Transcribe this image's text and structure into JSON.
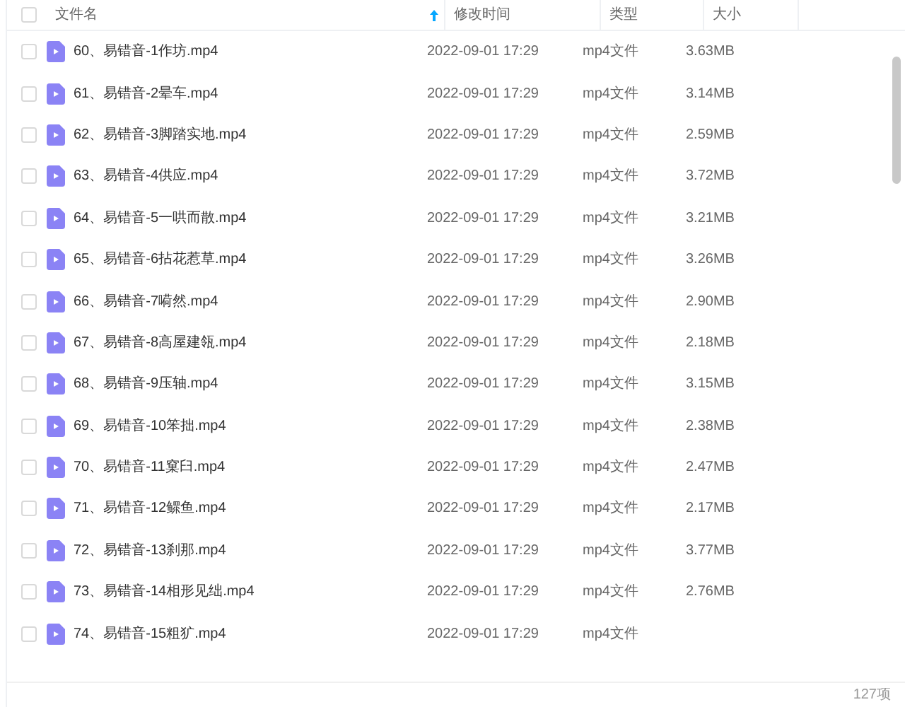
{
  "table": {
    "select_all": {
      "checked": false
    },
    "columns": [
      {
        "label": "文件名",
        "sorted": true
      },
      {
        "label": "修改时间",
        "sorted": false
      },
      {
        "label": "类型",
        "sorted": false
      },
      {
        "label": "大小",
        "sorted": false
      }
    ],
    "rows": [
      {
        "name": "60、易错音-1作坊.mp4",
        "modified": "2022-09-01 17:29",
        "type": "mp4文件",
        "size": "3.63MB",
        "selected": false
      },
      {
        "name": "61、易错音-2晕车.mp4",
        "modified": "2022-09-01 17:29",
        "type": "mp4文件",
        "size": "3.14MB",
        "selected": false
      },
      {
        "name": "62、易错音-3脚踏实地.mp4",
        "modified": "2022-09-01 17:29",
        "type": "mp4文件",
        "size": "2.59MB",
        "selected": false
      },
      {
        "name": "63、易错音-4供应.mp4",
        "modified": "2022-09-01 17:29",
        "type": "mp4文件",
        "size": "3.72MB",
        "selected": false
      },
      {
        "name": "64、易错音-5一哄而散.mp4",
        "modified": "2022-09-01 17:29",
        "type": "mp4文件",
        "size": "3.21MB",
        "selected": false
      },
      {
        "name": "65、易错音-6拈花惹草.mp4",
        "modified": "2022-09-01 17:29",
        "type": "mp4文件",
        "size": "3.26MB",
        "selected": false
      },
      {
        "name": "66、易错音-7嗬然.mp4",
        "modified": "2022-09-01 17:29",
        "type": "mp4文件",
        "size": "2.90MB",
        "selected": false
      },
      {
        "name": "67、易错音-8高屋建瓴.mp4",
        "modified": "2022-09-01 17:29",
        "type": "mp4文件",
        "size": "2.18MB",
        "selected": false
      },
      {
        "name": "68、易错音-9压轴.mp4",
        "modified": "2022-09-01 17:29",
        "type": "mp4文件",
        "size": "3.15MB",
        "selected": false
      },
      {
        "name": "69、易错音-10笨拙.mp4",
        "modified": "2022-09-01 17:29",
        "type": "mp4文件",
        "size": "2.38MB",
        "selected": false
      },
      {
        "name": "70、易错音-11窠臼.mp4",
        "modified": "2022-09-01 17:29",
        "type": "mp4文件",
        "size": "2.47MB",
        "selected": false
      },
      {
        "name": "71、易错音-12鳏鱼.mp4",
        "modified": "2022-09-01 17:29",
        "type": "mp4文件",
        "size": "2.17MB",
        "selected": false
      },
      {
        "name": "72、易错音-13刹那.mp4",
        "modified": "2022-09-01 17:29",
        "type": "mp4文件",
        "size": "3.77MB",
        "selected": false
      },
      {
        "name": "73、易错音-14相形见绌.mp4",
        "modified": "2022-09-01 17:29",
        "type": "mp4文件",
        "size": "2.76MB",
        "selected": false
      },
      {
        "name": "74、易错音-15粗犷.mp4",
        "modified": "2022-09-01 17:29",
        "type": "mp4文件",
        "selected": false
      }
    ]
  },
  "status_bar": {
    "count": "127项"
  }
}
